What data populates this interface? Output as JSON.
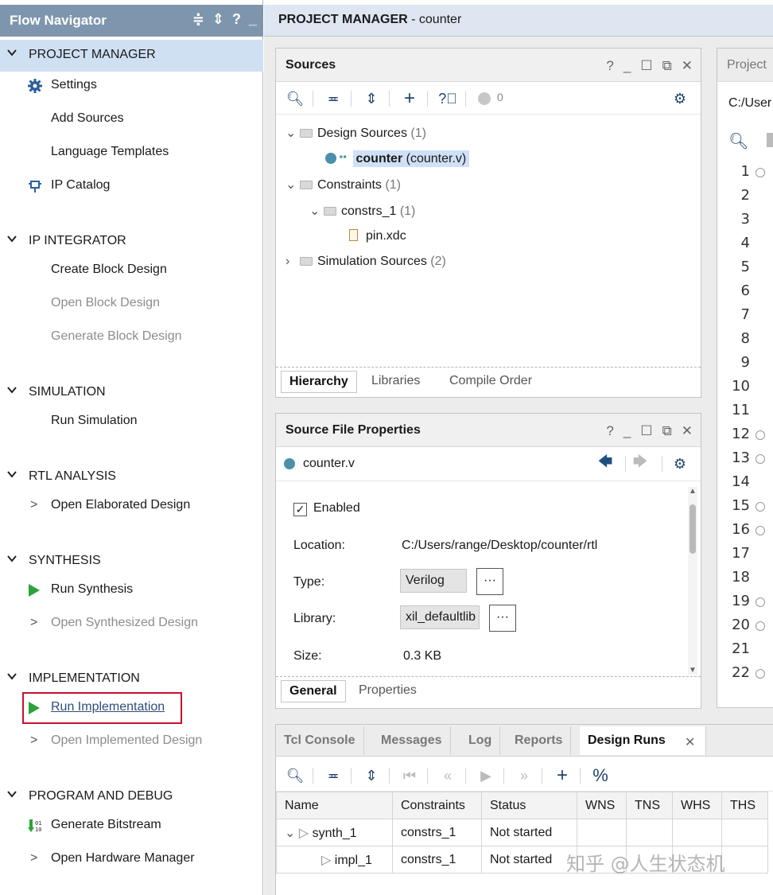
{
  "flow_navigator": {
    "title": "Flow Navigator",
    "tools": [
      "≑",
      "⇕",
      "?",
      "_"
    ],
    "sections": [
      {
        "label": "PROJECT MANAGER",
        "items": [
          {
            "label": "Settings",
            "icon": "gear-icon"
          },
          {
            "label": "Add Sources"
          },
          {
            "label": "Language Templates"
          },
          {
            "label": "IP Catalog",
            "icon": "ip-plug-icon"
          }
        ]
      },
      {
        "label": "IP INTEGRATOR",
        "items": [
          {
            "label": "Create Block Design"
          },
          {
            "label": "Open Block Design"
          },
          {
            "label": "Generate Block Design"
          }
        ]
      },
      {
        "label": "SIMULATION",
        "items": [
          {
            "label": "Run Simulation"
          }
        ]
      },
      {
        "label": "RTL ANALYSIS",
        "items": [
          {
            "label": "Open Elaborated Design"
          }
        ]
      },
      {
        "label": "SYNTHESIS",
        "items": [
          {
            "label": "Run Synthesis",
            "icon": "play-icon"
          },
          {
            "label": "Open Synthesized Design"
          }
        ]
      },
      {
        "label": "IMPLEMENTATION",
        "items": [
          {
            "label": "Run Implementation",
            "icon": "play-icon"
          },
          {
            "label": "Open Implemented Design"
          }
        ]
      },
      {
        "label": "PROGRAM AND DEBUG",
        "items": [
          {
            "label": "Generate Bitstream",
            "icon": "bitstream-icon"
          },
          {
            "label": "Open Hardware Manager"
          }
        ]
      }
    ]
  },
  "header": {
    "prefix": "PROJECT MANAGER",
    "suffix": " - counter"
  },
  "sources": {
    "title": "Sources",
    "badge": "0",
    "tree": {
      "design_sources": {
        "label": "Design Sources",
        "count": "(1)"
      },
      "top_module": {
        "name": "counter",
        "file": "(counter.v)"
      },
      "constraints": {
        "label": "Constraints",
        "count": "(1)"
      },
      "constrs": {
        "label": "constrs_1",
        "count": "(1)"
      },
      "xdc": {
        "label": "pin.xdc"
      },
      "sim_sources": {
        "label": "Simulation Sources",
        "count": "(2)"
      }
    },
    "tabs": [
      "Hierarchy",
      "Libraries",
      "Compile Order"
    ]
  },
  "file_props": {
    "title": "Source File Properties",
    "file": "counter.v",
    "enabled_label": "Enabled",
    "location_label": "Location:",
    "location": "C:/Users/range/Desktop/counter/rtl",
    "type_label": "Type:",
    "type": "Verilog",
    "library_label": "Library:",
    "library": "xil_defaultlib",
    "size_label": "Size:",
    "size": "0.3 KB",
    "dots": "···",
    "tabs": [
      "General",
      "Properties"
    ]
  },
  "project_panel": {
    "title": "Project",
    "path": "C:/User",
    "line_numbers": [
      "1",
      "2",
      "3",
      "4",
      "5",
      "6",
      "7",
      "8",
      "9",
      "10",
      "11",
      "12",
      "13",
      "14",
      "15",
      "16",
      "17",
      "18",
      "19",
      "20",
      "21",
      "22"
    ]
  },
  "bottom": {
    "tabs": [
      "Tcl Console",
      "Messages",
      "Log",
      "Reports",
      "Design Runs"
    ],
    "columns": [
      "Name",
      "Constraints",
      "Status",
      "WNS",
      "TNS",
      "WHS",
      "THS"
    ],
    "rows": [
      {
        "name": "synth_1",
        "constraints": "constrs_1",
        "status": "Not started"
      },
      {
        "name": "impl_1",
        "constraints": "constrs_1",
        "status": "Not started"
      }
    ]
  },
  "watermark": "知乎 @人生状态机",
  "colors": {
    "nav_header": "#7e96ad",
    "active_section": "#cfe0f3",
    "play": "#2aa43a",
    "highlight": "#c8102e"
  }
}
